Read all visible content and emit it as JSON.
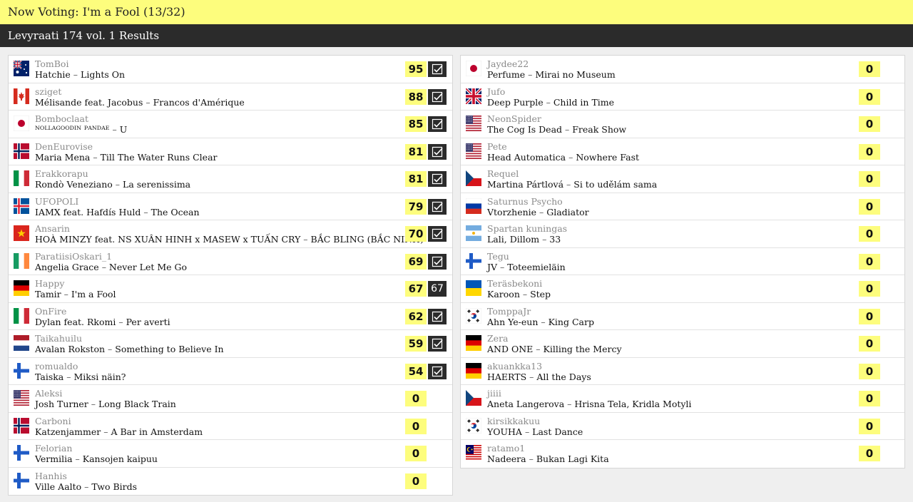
{
  "header": {
    "now_voting": "Now Voting: I'm a Fool (13/32)",
    "title": "Levyraati 174 vol. 1 Results"
  },
  "colors": {
    "accent_yellow": "#fdfd7d",
    "dark_bar": "#2b2b2b"
  },
  "left": [
    {
      "flag": "australia",
      "user": "TomBoi",
      "artist": "Hatchie",
      "song": "Lights On",
      "score": "95",
      "voted": true
    },
    {
      "flag": "canada",
      "user": "sziget",
      "artist": "Mélisande feat. Jacobus",
      "song": "Francos d'Amérique",
      "score": "88",
      "voted": true
    },
    {
      "flag": "japan",
      "user": "Bomboclaat",
      "artist": "ᴺᴼᴸᴸᴬᴳᴼᴼᴰᴵᴺ ᴾᴬᴺᴰᴬᴱ",
      "song": "U",
      "score": "85",
      "voted": true
    },
    {
      "flag": "norway",
      "user": "DenEurovise",
      "artist": "Maria Mena",
      "song": "Till The Water Runs Clear",
      "score": "81",
      "voted": true
    },
    {
      "flag": "italy",
      "user": "Erakkorapu",
      "artist": "Rondò Veneziano",
      "song": "La serenissima",
      "score": "81",
      "voted": true
    },
    {
      "flag": "iceland",
      "user": "UFOPOLI",
      "artist": "IAMX feat. Hafdís Huld",
      "song": "The Ocean",
      "score": "79",
      "voted": true
    },
    {
      "flag": "vietnam",
      "user": "Ansarin",
      "artist": "HOÀ MINZY feat. NS XUÂN HINH x MASEW x TUẤN CRY",
      "song": "BẮC BLING (BẮC NINH)",
      "score": "70",
      "voted": true
    },
    {
      "flag": "ireland",
      "user": "ParatiisiOskari_1",
      "artist": "Angelia Grace",
      "song": "Never Let Me Go",
      "score": "69",
      "voted": true
    },
    {
      "flag": "germany",
      "user": "Happy",
      "artist": "Tamir",
      "song": "I'm a Fool",
      "score": "67",
      "voted": false,
      "badge_text": "67"
    },
    {
      "flag": "italy",
      "user": "OnFire",
      "artist": "Dylan feat. Rkomi",
      "song": "Per averti",
      "score": "62",
      "voted": true
    },
    {
      "flag": "netherlands",
      "user": "Taikahuilu",
      "artist": "Avalan Rokston",
      "song": "Something to Believe In",
      "score": "59",
      "voted": true
    },
    {
      "flag": "finland",
      "user": "romualdo",
      "artist": "Taiska",
      "song": "Miksi näin?",
      "score": "54",
      "voted": true
    },
    {
      "flag": "usa",
      "user": "Aleksi",
      "artist": "Josh Turner",
      "song": "Long Black Train",
      "score": "0",
      "voted": null
    },
    {
      "flag": "norway",
      "user": "Carboni",
      "artist": "Katzenjammer",
      "song": "A Bar in Amsterdam",
      "score": "0",
      "voted": null
    },
    {
      "flag": "finland",
      "user": "Felorian",
      "artist": "Vermilia",
      "song": "Kansojen kaipuu",
      "score": "0",
      "voted": null
    },
    {
      "flag": "finland",
      "user": "Hanhis",
      "artist": "Ville Aalto",
      "song": "Two Birds",
      "score": "0",
      "voted": null
    }
  ],
  "right": [
    {
      "flag": "japan",
      "user": "Jaydee22",
      "artist": "Perfume",
      "song": "Mirai no Museum",
      "score": "0"
    },
    {
      "flag": "uk",
      "user": "Jufo",
      "artist": "Deep Purple",
      "song": "Child in Time",
      "score": "0"
    },
    {
      "flag": "usa",
      "user": "NeonSpider",
      "artist": "The Cog Is Dead",
      "song": "Freak Show",
      "score": "0"
    },
    {
      "flag": "usa",
      "user": "Pete",
      "artist": "Head Automatica",
      "song": "Nowhere Fast",
      "score": "0"
    },
    {
      "flag": "czech",
      "user": "Requel",
      "artist": "Martina Pártlová",
      "song": "Si to udělám sama",
      "score": "0"
    },
    {
      "flag": "russia",
      "user": "Saturnus Psycho",
      "artist": "Vtorzhenie",
      "song": "Gladiator",
      "score": "0"
    },
    {
      "flag": "argentina",
      "user": "Spartan kuningas",
      "artist": "Lali, Dillom",
      "song": "33",
      "score": "0"
    },
    {
      "flag": "finland",
      "user": "Tegu",
      "artist": "JV",
      "song": "Toteemieläin",
      "score": "0"
    },
    {
      "flag": "ukraine",
      "user": "Teräsbekoni",
      "artist": "Karoon",
      "song": "Step",
      "score": "0"
    },
    {
      "flag": "korea",
      "user": "TomppaJr",
      "artist": "Ahn Ye-eun",
      "song": "King Carp",
      "score": "0"
    },
    {
      "flag": "germany",
      "user": "Zera",
      "artist": "AND ONE",
      "song": "Killing the Mercy",
      "score": "0"
    },
    {
      "flag": "germany",
      "user": "akuankka13",
      "artist": "HAERTS",
      "song": "All the Days",
      "score": "0"
    },
    {
      "flag": "czech",
      "user": "jiiii",
      "artist": "Aneta Langerova",
      "song": "Hrisna Tela, Kridla Motyli",
      "score": "0"
    },
    {
      "flag": "korea",
      "user": "kirsikkakuu",
      "artist": "YOUHA",
      "song": "Last Dance",
      "score": "0"
    },
    {
      "flag": "malaysia",
      "user": "ratamo1",
      "artist": "Nadeera",
      "song": "Bukan Lagi Kita",
      "score": "0"
    }
  ]
}
